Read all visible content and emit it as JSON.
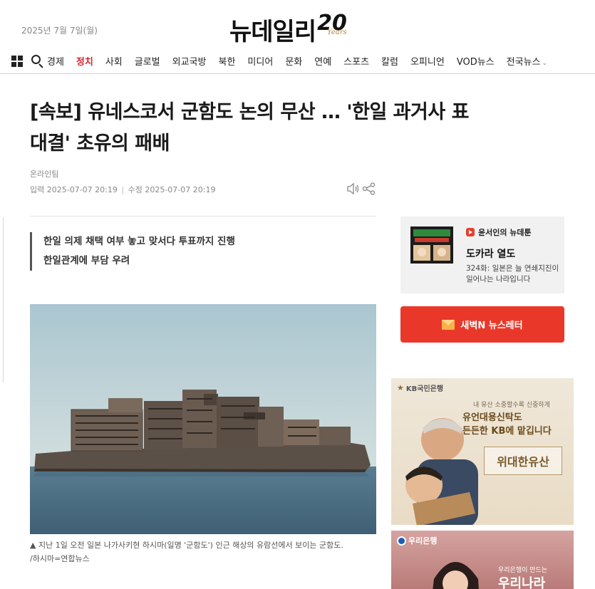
{
  "header": {
    "date": "2025년 7월 7일(월)",
    "logo_text": "뉴데일리",
    "logo_badge_number": "20",
    "logo_badge_label": "Years"
  },
  "nav": {
    "items": [
      {
        "label": "경제",
        "active": false
      },
      {
        "label": "정치",
        "active": true
      },
      {
        "label": "사회",
        "active": false
      },
      {
        "label": "글로벌",
        "active": false
      },
      {
        "label": "외교국방",
        "active": false
      },
      {
        "label": "북한",
        "active": false
      },
      {
        "label": "미디어",
        "active": false
      },
      {
        "label": "문화",
        "active": false
      },
      {
        "label": "연예",
        "active": false
      },
      {
        "label": "스포츠",
        "active": false
      },
      {
        "label": "칼럼",
        "active": false
      },
      {
        "label": "오피니언",
        "active": false
      },
      {
        "label": "VOD뉴스",
        "active": false
      },
      {
        "label": "전국뉴스",
        "active": false
      }
    ],
    "accent_color": "#d8232a"
  },
  "article": {
    "headline_line1": "[속보] 유네스코서 군함도 논의 무산 … '한일 과거사 표",
    "headline_line2": "대결' 초유의 패배",
    "byline": "온라인팀",
    "input_label": "입력",
    "input_time": "2025-07-07 20:19",
    "modified_label": "수정",
    "modified_time": "2025-07-07 20:19",
    "summary": [
      "한일 의제 채택 여부 놓고 맞서다 투표까지 진행",
      "한일관계에 부담 우려"
    ],
    "caption_line1": "▲ 지난 1일 오전 일본 나가사키현 하시마(일명 '군함도') 인근 해상의 유람선에서 보이는 군함도.",
    "caption_line2": "/하시마=연합뉴스"
  },
  "sidebar": {
    "series_name": "윤서인의 뉴데툰",
    "title": "도카라 열도",
    "description": "324화: 일본은 늘 연쇄지진이 일어나는 나라입니다",
    "newsletter_label": "새벽N 뉴스레터",
    "newsletter_color": "#e9382a"
  },
  "ads": {
    "kb": {
      "bank": "KB국민은행",
      "line1": "내 유산 소중할수록 신중하게",
      "line2": "유언대용신탁도",
      "line3": "든든한 KB에 맡깁니다",
      "brand": "위대한유산"
    },
    "woori": {
      "bank": "우리은행",
      "line1": "우리은행이 만드는",
      "line2": "우리나라"
    }
  }
}
